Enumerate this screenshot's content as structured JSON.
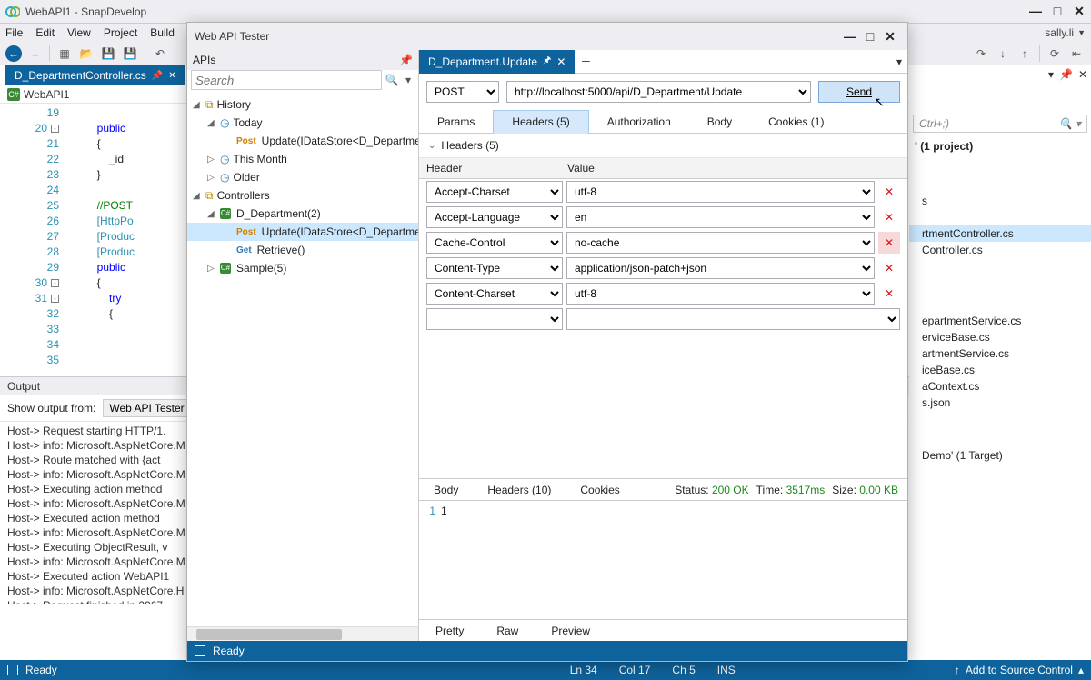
{
  "app": {
    "title": "WebAPI1 - SnapDevelop",
    "user": "sally.li"
  },
  "menu": [
    "File",
    "Edit",
    "View",
    "Project",
    "Build"
  ],
  "docTabs": {
    "active": "D_DepartmentController.cs"
  },
  "breadcrumb": {
    "item": "WebAPI1"
  },
  "code": {
    "lines": [
      {
        "n": 19,
        "t": ""
      },
      {
        "n": 20,
        "t": "        public",
        "cls": "kw",
        "rest": ""
      },
      {
        "n": 21,
        "t": "        {"
      },
      {
        "n": 22,
        "t": "            _id"
      },
      {
        "n": 23,
        "t": "        }"
      },
      {
        "n": 24,
        "t": ""
      },
      {
        "n": 25,
        "t": "        //POST",
        "cls": "cm"
      },
      {
        "n": 26,
        "t": "        [HttpPo",
        "cls": "attr"
      },
      {
        "n": 27,
        "t": "        [Produc",
        "cls": "attr"
      },
      {
        "n": 28,
        "t": "        [Produc",
        "cls": "attr"
      },
      {
        "n": 29,
        "t": "        public",
        "cls": "kw"
      },
      {
        "n": 30,
        "t": "        {"
      },
      {
        "n": 31,
        "t": "            try",
        "cls": "kw"
      },
      {
        "n": 32,
        "t": "            {"
      },
      {
        "n": 33,
        "t": ""
      },
      {
        "n": 34,
        "t": ""
      },
      {
        "n": 35,
        "t": ""
      }
    ]
  },
  "output": {
    "title": "Output",
    "label": "Show output from:",
    "source": "Web API Tester",
    "lines": [
      "Host->      Request starting HTTP/1.",
      "Host-> info: Microsoft.AspNetCore.M",
      "Host->      Route matched with {act",
      "Host-> info: Microsoft.AspNetCore.M",
      "Host->      Executing action method",
      "Host-> info: Microsoft.AspNetCore.M",
      "Host->      Executed action method",
      "Host-> info: Microsoft.AspNetCore.M",
      "Host->      Executing ObjectResult, v",
      "Host-> info: Microsoft.AspNetCore.M",
      "Host->      Executed action WebAPI1",
      "Host-> info: Microsoft.AspNetCore.H",
      "Host->      Request finished in 2967."
    ]
  },
  "solution": {
    "search": "Ctrl+;)",
    "root": "' (1 project)",
    "item_s": "s",
    "controllerSel": "rtmentController.cs",
    "controller2": "Controller.cs",
    "svc": [
      "epartmentService.cs",
      "erviceBase.cs",
      "artmentService.cs",
      "iceBase.cs",
      "aContext.cs",
      "s.json"
    ],
    "demo": "Demo' (1 Target)"
  },
  "ideStatus": {
    "ready": "Ready",
    "ln": "Ln 34",
    "col": "Col 17",
    "ch": "Ch 5",
    "ins": "INS",
    "scc": "Add to Source Control"
  },
  "tester": {
    "title": "Web API Tester",
    "apis": {
      "title": "APIs",
      "search": "Search",
      "tree": {
        "history": "History",
        "today": "Today",
        "todayItem": "Update(IDataStore<D_Departme",
        "thisMonth": "This Month",
        "older": "Older",
        "controllers": "Controllers",
        "dept": "D_Department(2)",
        "deptUpdate": "Update(IDataStore<D_Departme",
        "deptRetrieve": "Retrieve()",
        "sample": "Sample(5)"
      }
    },
    "reqTab": "D_Department.Update",
    "request": {
      "method": "POST",
      "url": "http://localhost:5000/api/D_Department/Update",
      "send": "Send"
    },
    "subtabs": {
      "params": "Params",
      "headers": "Headers  (5)",
      "auth": "Authorization",
      "body": "Body",
      "cookies": "Cookies  (1)"
    },
    "headersTitle": "Headers  (5)",
    "gridHead": {
      "header": "Header",
      "value": "Value"
    },
    "headers": [
      {
        "k": "Accept-Charset",
        "v": "utf-8"
      },
      {
        "k": "Accept-Language",
        "v": "en"
      },
      {
        "k": "Cache-Control",
        "v": "no-cache",
        "delActive": true
      },
      {
        "k": "Content-Type",
        "v": "application/json-patch+json"
      },
      {
        "k": "Content-Charset",
        "v": "utf-8"
      },
      {
        "k": "",
        "v": ""
      }
    ],
    "response": {
      "tabs": {
        "body": "Body",
        "headers": "Headers  (10)",
        "cookies": "Cookies"
      },
      "statusLabel": "Status:",
      "status": "200 OK",
      "timeLabel": "Time:",
      "time": "3517ms",
      "sizeLabel": "Size:",
      "size": "0.00 KB",
      "bodyLine": "1",
      "bodyVal": "1",
      "views": {
        "pretty": "Pretty",
        "raw": "Raw",
        "preview": "Preview"
      }
    },
    "status": "Ready"
  }
}
